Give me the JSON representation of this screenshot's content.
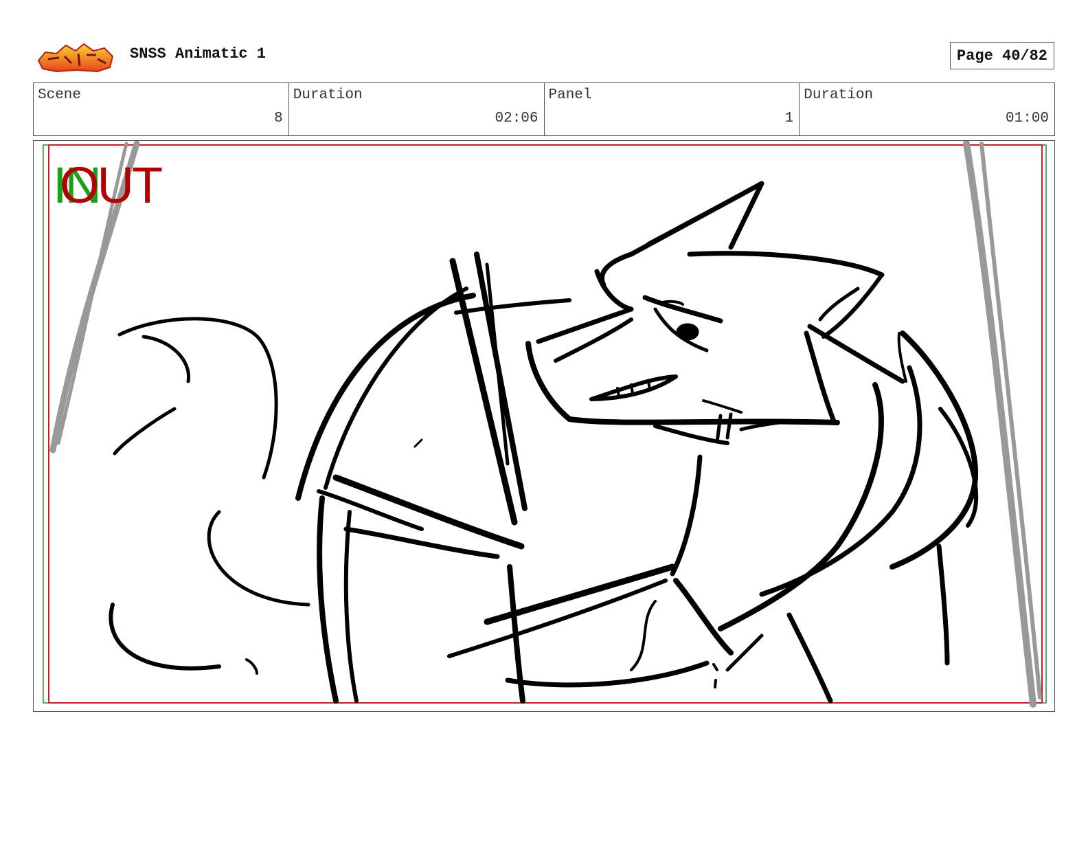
{
  "header": {
    "logo_name": "show-logo",
    "title": "SNSS Animatic 1",
    "page": "Page 40/82"
  },
  "info": {
    "scene_label": "Scene",
    "scene_value": "8",
    "scene_duration_label": "Duration",
    "scene_duration_value": "02:06",
    "panel_label": "Panel",
    "panel_value": "1",
    "panel_duration_label": "Duration",
    "panel_duration_value": "01:00"
  },
  "panel_image": {
    "in_marker": "IN",
    "out_marker": "OUT",
    "colors": {
      "in": "#1aa01a",
      "out": "#b00000",
      "safe_frame": "#c0202a",
      "curtain": "#999999"
    }
  }
}
